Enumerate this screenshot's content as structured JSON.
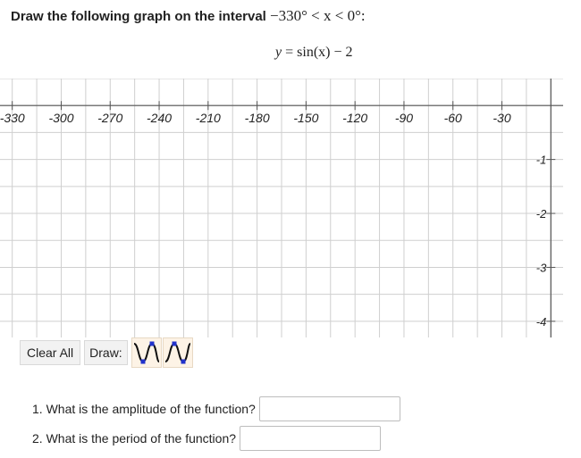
{
  "prompt": {
    "text": "Draw the following graph on the interval",
    "interval": "−330° < x < 0°:"
  },
  "function": {
    "y": "y",
    "eq": " = ",
    "rhs": "sin(x) − 2"
  },
  "graph": {
    "x_tick_labels": [
      "-330",
      "-300",
      "-270",
      "-240",
      "-210",
      "-180",
      "-150",
      "-120",
      "-90",
      "-60",
      "-30"
    ],
    "y_tick_labels": [
      "-1",
      "-2",
      "-3",
      "-4"
    ],
    "x_ticks": [
      -330,
      -300,
      -270,
      -240,
      -210,
      -180,
      -150,
      -120,
      -90,
      -60,
      -30
    ],
    "y_ticks": [
      -1,
      -2,
      -3,
      -4
    ],
    "xlim": [
      -337.5,
      7.5
    ],
    "ylim": [
      -4.3,
      0.5
    ],
    "grid": true,
    "x_minor_step": 15,
    "y_minor_step": 0.5
  },
  "controls": {
    "clear_all": "Clear All",
    "draw_label": "Draw:",
    "tools": [
      "sine-tool",
      "cosine-tool"
    ]
  },
  "questions": [
    {
      "label": "1. What is the amplitude of the function?",
      "value": ""
    },
    {
      "label": "2. What is the period of the function?",
      "value": ""
    }
  ]
}
